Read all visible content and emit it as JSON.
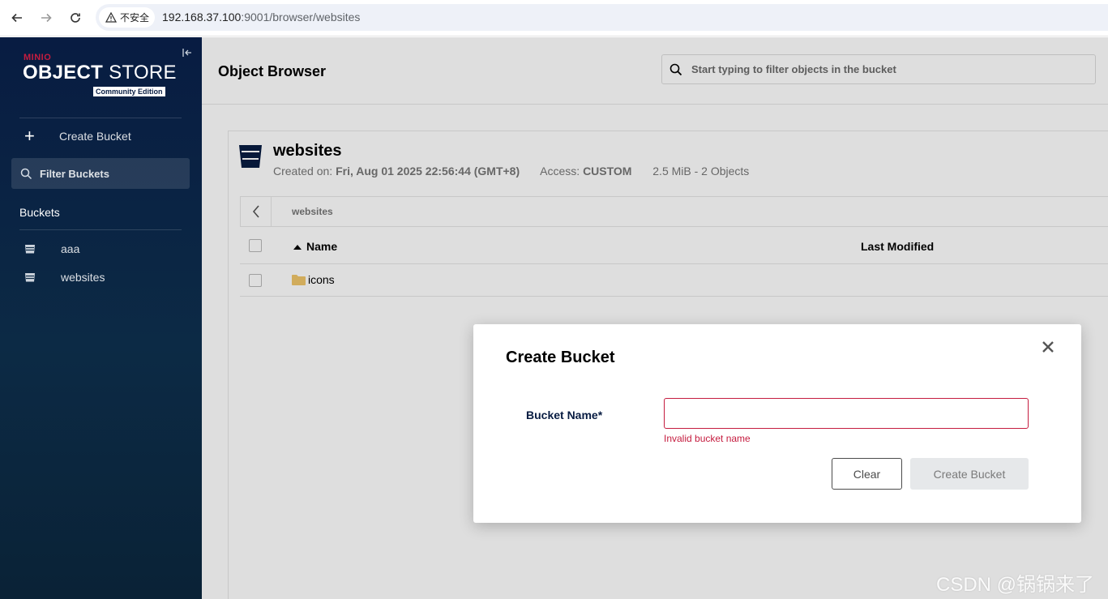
{
  "browser": {
    "security_label": "不安全",
    "url_host": "192.168.37.100",
    "url_port_path": ":9001/browser/websites"
  },
  "sidebar": {
    "logo_brand": "MINIO",
    "logo_title_bold": "OBJECT",
    "logo_title_light": " STORE",
    "logo_edition": "Community Edition",
    "create_bucket_label": "Create Bucket",
    "filter_buckets_label": "Filter Buckets",
    "buckets_section_label": "Buckets",
    "buckets": [
      {
        "name": "aaa"
      },
      {
        "name": "websites"
      }
    ]
  },
  "header": {
    "title": "Object Browser",
    "search_placeholder": "Start typing to filter objects in the bucket"
  },
  "bucket": {
    "name": "websites",
    "created_label": "Created on:",
    "created_value": "Fri, Aug 01 2025 22:56:44 (GMT+8)",
    "access_label": "Access:",
    "access_value": "CUSTOM",
    "size_summary": "2.5 MiB - 2 Objects",
    "breadcrumb": "websites"
  },
  "table": {
    "columns": {
      "name": "Name",
      "last_modified": "Last Modified"
    },
    "rows": [
      {
        "name": "icons",
        "type": "folder"
      }
    ]
  },
  "modal": {
    "title": "Create Bucket",
    "field_label": "Bucket Name*",
    "field_value": "",
    "error_text": "Invalid bucket name",
    "clear_label": "Clear",
    "create_label": "Create Bucket"
  },
  "watermark": "CSDN @锅锅来了",
  "colors": {
    "sidebar_bg": "#081c42",
    "brand_red": "#c51c3f",
    "folder": "#f0c66a"
  }
}
